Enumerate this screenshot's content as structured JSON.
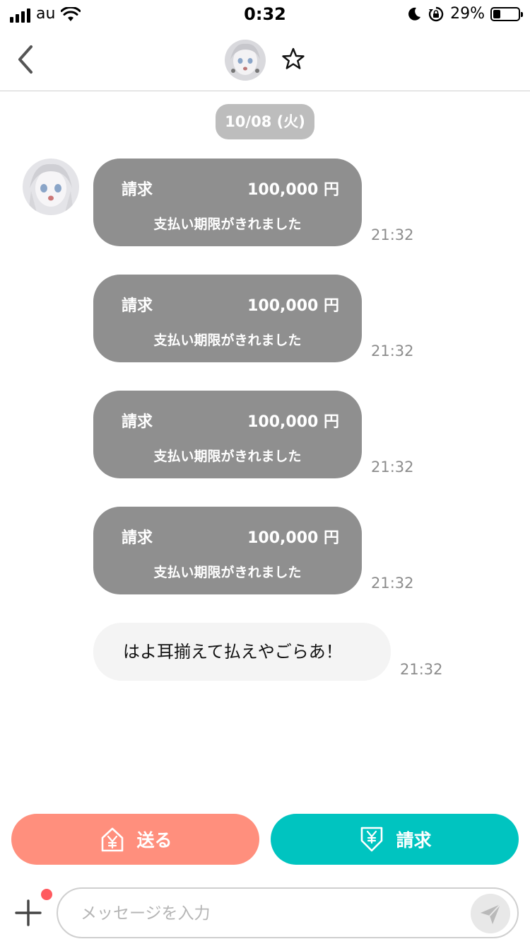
{
  "status_bar": {
    "carrier": "au",
    "time": "0:32",
    "battery_percent": "29%",
    "battery_level": 0.29,
    "icons": [
      "signal-icon",
      "wifi-icon",
      "moon-icon",
      "rotation-lock-icon",
      "battery-icon"
    ]
  },
  "header": {
    "back_icon": "chevron-left-icon",
    "favorite_icon": "star-outline-icon"
  },
  "chat": {
    "date": "10/08 (火)",
    "bills": [
      {
        "label": "請求",
        "amount": "100,000 円",
        "status": "支払い期限がきれました",
        "time": "21:32"
      },
      {
        "label": "請求",
        "amount": "100,000 円",
        "status": "支払い期限がきれました",
        "time": "21:32"
      },
      {
        "label": "請求",
        "amount": "100,000 円",
        "status": "支払い期限がきれました",
        "time": "21:32"
      },
      {
        "label": "請求",
        "amount": "100,000 円",
        "status": "支払い期限がきれました",
        "time": "21:32"
      }
    ],
    "text_message": {
      "text": "はよ耳揃えて払えやごらあ！",
      "time": "21:32"
    }
  },
  "actions": {
    "send_label": "送る",
    "request_label": "請求",
    "send_color": "#ff8f7d",
    "request_color": "#00c4c0"
  },
  "composer": {
    "placeholder": "メッセージを入力",
    "value": ""
  }
}
